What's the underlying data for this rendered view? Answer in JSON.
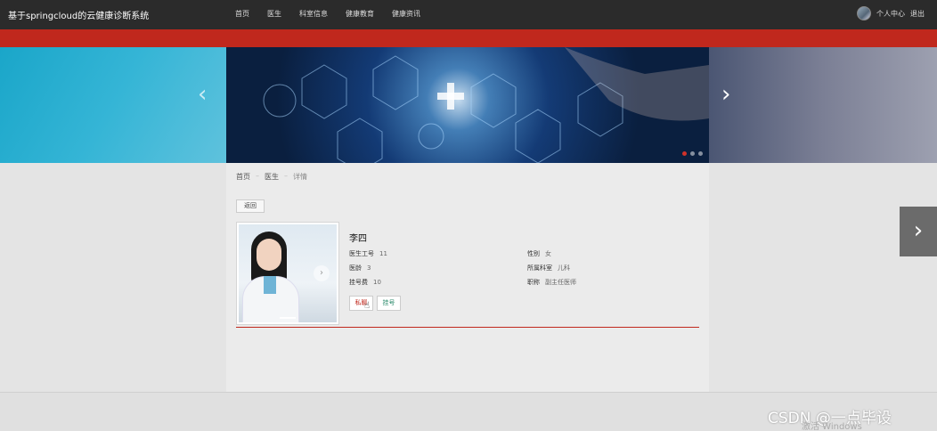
{
  "app": {
    "title": "基于springcloud的云健康诊断系统"
  },
  "nav": {
    "items": [
      "首页",
      "医生",
      "科室信息",
      "健康教育",
      "健康资讯"
    ]
  },
  "user": {
    "center": "个人中心",
    "logout": "退出"
  },
  "breadcrumb": {
    "home": "首页",
    "section": "医生",
    "current": "详情"
  },
  "back_label": "返回",
  "doctor": {
    "name": "李四",
    "labels": {
      "id": "医生工号",
      "gender": "性别",
      "age": "医龄",
      "dept": "所属科室",
      "fee": "挂号费",
      "title": "职称"
    },
    "values": {
      "id": "11",
      "gender": "女",
      "age": "3",
      "dept": "儿科",
      "fee": "10",
      "title": "副主任医师"
    }
  },
  "actions": {
    "message": "私聊",
    "register": "挂号"
  },
  "watermarks": {
    "csdn": "CSDN @一点毕设",
    "windows": "激活 Windows"
  },
  "colors": {
    "accent": "#c0281d",
    "topbar": "#2b2b2b"
  }
}
